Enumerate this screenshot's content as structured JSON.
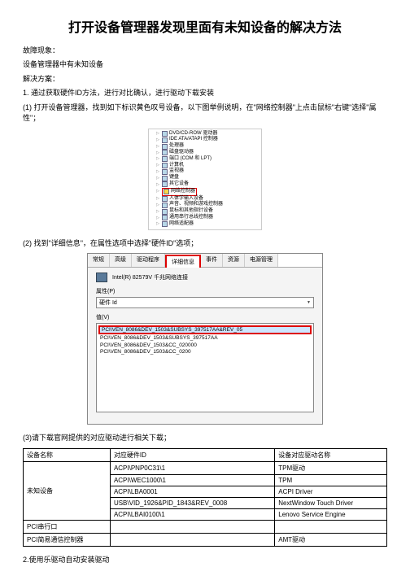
{
  "title": "打开设备管理器发现里面有未知设备的解决方法",
  "fault_label": "故障现象：",
  "fault_text": "设备管理器中有未知设备",
  "solution_label": "解决方案：",
  "step1": "1. 通过获取硬件ID方法，进行对比确认，进行驱动下载安装",
  "step1_1": "(1) 打开设备管理器，找到如下标识黄色叹号设备，以下图举例说明，在\"网络控制器\"上点击鼠标\"右键\"选择\"属性\"；",
  "devtree": {
    "items": [
      "DVD/CD-ROW 驱动器",
      "IDE ATA/ATAPI 控制器",
      "处理器",
      "磁盘驱动器",
      "端口 (COM 和 LPT)",
      "计算机",
      "监视器",
      "键盘",
      "其它设备"
    ],
    "highlight": "网络控制器",
    "after": [
      "人体学输入设备",
      "声音、视频和游戏控制器",
      "鼠标和其他指针设备",
      "通用串行总线控制器",
      "网络适配器"
    ]
  },
  "step1_2": "(2) 找到\"详细信息\"，在属性选项中选择\"硬件ID\"选项；",
  "dlg": {
    "tabs": [
      "常规",
      "高级",
      "驱动程序",
      "详细信息",
      "事件",
      "资源",
      "电源管理"
    ],
    "active_tab": 3,
    "device_name": "Intel(R) 82579V 千兆网络连接",
    "prop_label": "属性(P)",
    "prop_value": "硬件 Id",
    "val_label": "值(V)",
    "values": [
      "PCI\\VEN_8086&DEV_1503&SUBSYS_397517AA&REV_05",
      "PCI\\VEN_8086&DEV_1503&SUBSYS_397517AA",
      "PCI\\VEN_8086&DEV_1503&CC_020000",
      "PCI\\VEN_8086&DEV_1503&CC_0200"
    ]
  },
  "step1_3": "(3)请下载官网提供的对应驱动进行相关下载；",
  "table": {
    "headers": [
      "设备名称",
      "对应硬件ID",
      "设备对应驱动名称"
    ],
    "rows": [
      {
        "name": "未知设备",
        "id": "ACPI\\PNP0C31\\1",
        "drv": "TPM驱动"
      },
      {
        "name": "",
        "id": "ACPI\\WEC1000\\1",
        "drv": "TPM"
      },
      {
        "name": "",
        "id": "ACPI\\LBA0001",
        "drv": "ACPI Driver"
      },
      {
        "name": "",
        "id": "USB\\VID_1926&PID_1843&REV_0008",
        "drv": "NextWindow Touch Driver"
      },
      {
        "name": "",
        "id": "ACPI\\LBAI0100\\1",
        "drv": "Lenovo Service Engine"
      },
      {
        "name": "PCI串行口",
        "id": "",
        "drv": ""
      },
      {
        "name": "PCI简易通信控制器",
        "id": "",
        "drv": "AMT驱动"
      }
    ]
  },
  "step2": "2.使用乐驱动自动安装驱动"
}
